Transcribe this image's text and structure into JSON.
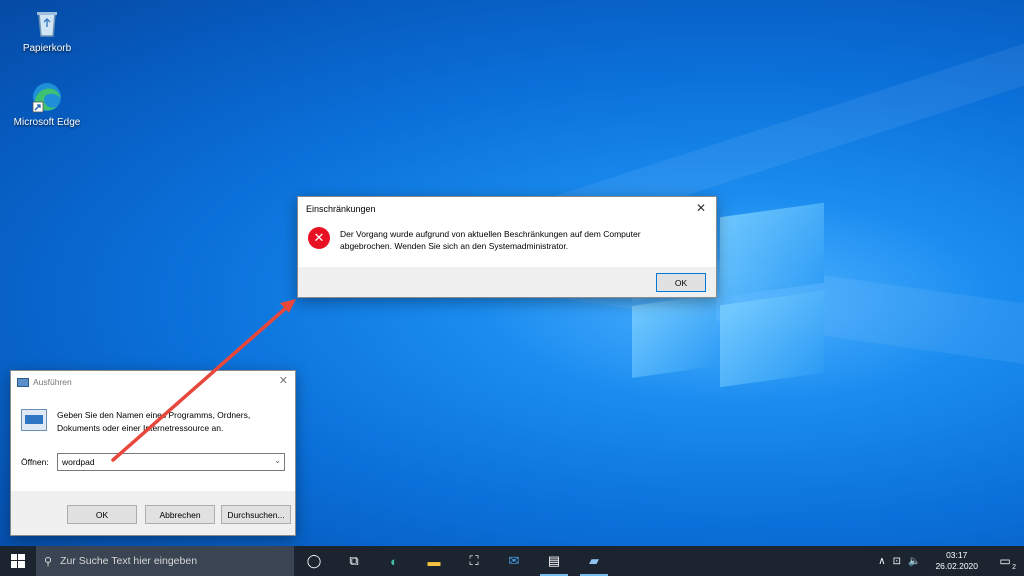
{
  "desktop": {
    "icons": [
      {
        "label": "Papierkorb",
        "icon": "recycle-bin-icon"
      },
      {
        "label": "Microsoft Edge",
        "icon": "edge-icon"
      }
    ]
  },
  "error_dialog": {
    "title": "Einschränkungen",
    "message_line1": "Der Vorgang wurde aufgrund von aktuellen Beschränkungen auf dem Computer",
    "message_line2": "abgebrochen. Wenden Sie sich an den Systemadministrator.",
    "ok_label": "OK",
    "close_glyph": "✕",
    "error_glyph": "✕",
    "icon": "error-icon"
  },
  "run_dialog": {
    "title": "Ausführen",
    "description_line1": "Geben Sie den Namen eines Programms, Ordners,",
    "description_line2": "Dokuments oder einer Internetressource an.",
    "open_label": "Öffnen:",
    "open_value": "wordpad",
    "ok_label": "OK",
    "cancel_label": "Abbrechen",
    "browse_label": "Durchsuchen...",
    "close_glyph": "✕",
    "dropdown_glyph": "⌄"
  },
  "taskbar": {
    "search_placeholder": "Zur Suche Text hier eingeben",
    "search_glyph": "⚲",
    "taskview_glyph": "◯",
    "apps": [
      {
        "name": "task-view",
        "glyph": "⧉"
      },
      {
        "name": "edge",
        "glyph": "◐"
      },
      {
        "name": "file-explorer",
        "glyph": "▬"
      },
      {
        "name": "store",
        "glyph": "⛶"
      },
      {
        "name": "mail",
        "glyph": "✉"
      },
      {
        "name": "wordpad",
        "glyph": "▤"
      },
      {
        "name": "run",
        "glyph": "▰"
      }
    ],
    "tray_glyphs": {
      "chevron": "∧",
      "network": "⊡",
      "volume": "🔈"
    },
    "time": "03:17",
    "date": "26.02.2020",
    "notification_count": "2",
    "notification_glyph": "▭"
  },
  "colors": {
    "error_red": "#e81123",
    "annotation_arrow": "#e8473b",
    "taskbar_bg": "#1c2430"
  }
}
